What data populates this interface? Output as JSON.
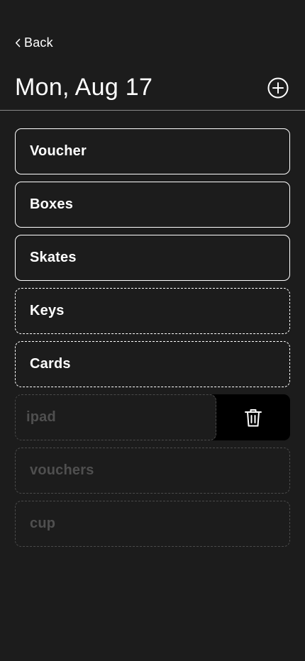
{
  "header": {
    "back_label": "Back",
    "title": "Mon, Aug 17"
  },
  "items": [
    {
      "label": "Voucher",
      "style": "solid"
    },
    {
      "label": "Boxes",
      "style": "solid"
    },
    {
      "label": "Skates",
      "style": "solid"
    },
    {
      "label": "Keys",
      "style": "dashed"
    },
    {
      "label": "Cards",
      "style": "dashed"
    },
    {
      "label": "ipad",
      "style": "faded-swiped"
    },
    {
      "label": "vouchers",
      "style": "faded"
    },
    {
      "label": "cup",
      "style": "faded"
    }
  ],
  "icons": {
    "back": "chevron-left-icon",
    "add": "plus-circle-icon",
    "delete": "trash-icon"
  },
  "colors": {
    "background": "#1c1c1c",
    "text": "#ffffff",
    "faded_text": "#4f4f4f",
    "delete_background": "#000000"
  }
}
